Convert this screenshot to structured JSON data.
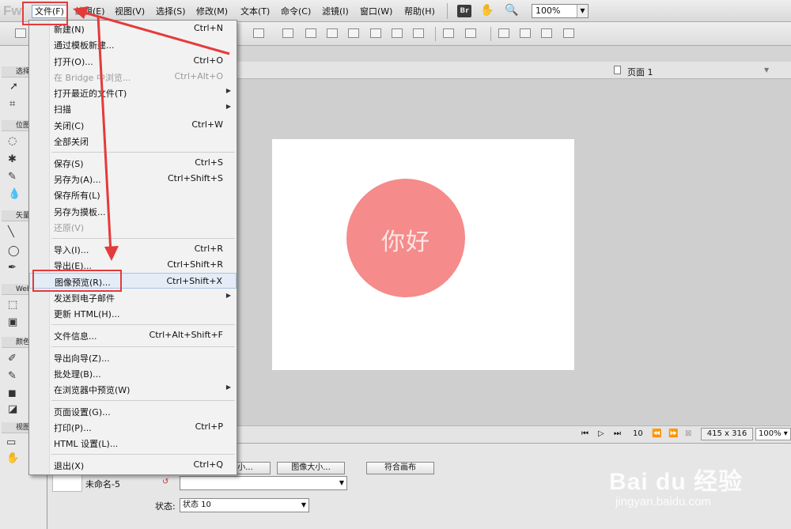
{
  "app": {
    "logo": "Fw"
  },
  "menubar": {
    "items": [
      "文件(F)",
      "编辑(E)",
      "视图(V)",
      "选择(S)",
      "修改(M)",
      "文本(T)",
      "命令(C)",
      "滤镜(I)",
      "窗口(W)",
      "帮助(H)"
    ],
    "br_icon": "Br",
    "zoom": "100%"
  },
  "file_menu": {
    "items": [
      {
        "label": "新建(N)",
        "shortcut": "Ctrl+N"
      },
      {
        "label": "通过模板新建...",
        "shortcut": ""
      },
      {
        "label": "打开(O)...",
        "shortcut": "Ctrl+O"
      },
      {
        "label": "在 Bridge 中浏览...",
        "shortcut": "Ctrl+Alt+O"
      },
      {
        "label": "打开最近的文件(T)",
        "shortcut": ""
      },
      {
        "label": "扫描",
        "shortcut": ""
      },
      {
        "label": "关闭(C)",
        "shortcut": "Ctrl+W"
      },
      {
        "label": "全部关闭",
        "shortcut": ""
      },
      {
        "label": "保存(S)",
        "shortcut": "Ctrl+S"
      },
      {
        "label": "另存为(A)...",
        "shortcut": "Ctrl+Shift+S"
      },
      {
        "label": "保存所有(L)",
        "shortcut": ""
      },
      {
        "label": "另存为摸板...",
        "shortcut": ""
      },
      {
        "label": "还原(V)",
        "shortcut": ""
      },
      {
        "label": "导入(I)...",
        "shortcut": "Ctrl+R"
      },
      {
        "label": "导出(E)...",
        "shortcut": "Ctrl+Shift+R"
      },
      {
        "label": "图像预览(R)...",
        "shortcut": "Ctrl+Shift+X"
      },
      {
        "label": "发送到电子邮件",
        "shortcut": ""
      },
      {
        "label": "更新 HTML(H)...",
        "shortcut": ""
      },
      {
        "label": "文件信息...",
        "shortcut": "Ctrl+Alt+Shift+F"
      },
      {
        "label": "导出向导(Z)...",
        "shortcut": ""
      },
      {
        "label": "批处理(B)...",
        "shortcut": ""
      },
      {
        "label": "在浏览器中预览(W)",
        "shortcut": ""
      },
      {
        "label": "页面设置(G)...",
        "shortcut": ""
      },
      {
        "label": "打印(P)...",
        "shortcut": "Ctrl+P"
      },
      {
        "label": "HTML 设置(L)...",
        "shortcut": ""
      },
      {
        "label": "退出(X)",
        "shortcut": "Ctrl+Q"
      }
    ]
  },
  "document": {
    "page_label": "页面 1",
    "canvas_text": "你好",
    "circle_color": "#f58b8b",
    "frame_count": "10",
    "size": "415 x 316",
    "zoom": "100%"
  },
  "properties": {
    "doc_name": "未命名-5",
    "canvas_size_button": "小...",
    "image_size_button": "图像大小...",
    "fit_canvas_button": "符合画布",
    "state_label": "状态:",
    "state_value": "状态 10"
  },
  "tools_panel": {
    "sections": [
      "选择",
      "位图",
      "矢量",
      "Web",
      "颜色",
      "视图"
    ]
  },
  "watermark": {
    "brand": "Bai du 经验",
    "url": "jingyan.baidu.com"
  },
  "colors": {
    "annotation": "#e53a3a",
    "menu_highlight": "#e4ecf7"
  }
}
